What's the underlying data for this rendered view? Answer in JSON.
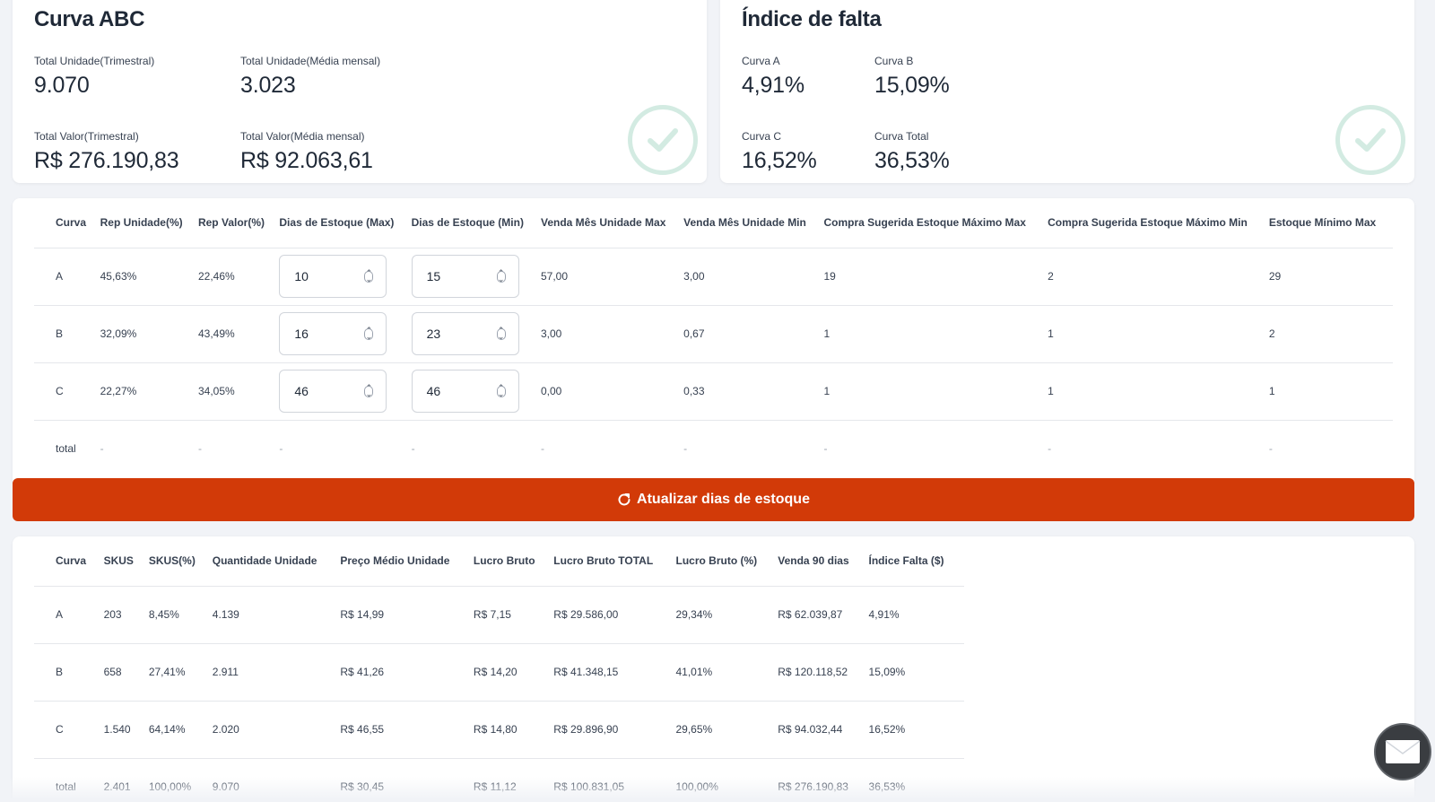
{
  "curva_abc": {
    "title": "Curva ABC",
    "total_unidade_trimestral": {
      "label": "Total Unidade(Trimestral)",
      "value": "9.070"
    },
    "total_unidade_media": {
      "label": "Total Unidade(Média mensal)",
      "value": "3.023"
    },
    "total_valor_trimestral": {
      "label": "Total Valor(Trimestral)",
      "value": "R$ 276.190,83"
    },
    "total_valor_media": {
      "label": "Total Valor(Média mensal)",
      "value": "R$ 92.063,61"
    },
    "status_icon": "check-circle-icon"
  },
  "indice_falta": {
    "title": "Índice de falta",
    "curva_a": {
      "label": "Curva A",
      "value": "4,91%"
    },
    "curva_b": {
      "label": "Curva B",
      "value": "15,09%"
    },
    "curva_c": {
      "label": "Curva C",
      "value": "16,52%"
    },
    "curva_total": {
      "label": "Curva Total",
      "value": "36,53%"
    },
    "status_icon": "check-circle-icon"
  },
  "estoque_table": {
    "headers": [
      "Curva",
      "Rep Unidade(%)",
      "Rep Valor(%)",
      "Dias de Estoque (Max)",
      "Dias de Estoque (Min)",
      "Venda Mês Unidade Max",
      "Venda Mês Unidade Min",
      "Compra Sugerida Estoque Máximo Max",
      "Compra Sugerida Estoque Máximo Min",
      "Estoque Mínimo Max"
    ],
    "rows": [
      {
        "curva": "A",
        "rep_unidade": "45,63%",
        "rep_valor": "22,46%",
        "dias_max": "10",
        "dias_min": "15",
        "venda_max": "57,00",
        "venda_min": "3,00",
        "compra_max": "19",
        "compra_min": "2",
        "estoque_min_max": "29"
      },
      {
        "curva": "B",
        "rep_unidade": "32,09%",
        "rep_valor": "43,49%",
        "dias_max": "16",
        "dias_min": "23",
        "venda_max": "3,00",
        "venda_min": "0,67",
        "compra_max": "1",
        "compra_min": "1",
        "estoque_min_max": "2"
      },
      {
        "curva": "C",
        "rep_unidade": "22,27%",
        "rep_valor": "34,05%",
        "dias_max": "46",
        "dias_min": "46",
        "venda_max": "0,00",
        "venda_min": "0,33",
        "compra_max": "1",
        "compra_min": "1",
        "estoque_min_max": "1"
      }
    ],
    "total_row": {
      "curva": "total",
      "placeholder": "-"
    }
  },
  "update_button": {
    "label": "Atualizar dias de estoque",
    "icon": "refresh-icon",
    "color": "#d23a08"
  },
  "resumo_table": {
    "headers": [
      "Curva",
      "SKUS",
      "SKUS(%)",
      "Quantidade Unidade",
      "Preço Médio Unidade",
      "Lucro Bruto",
      "Lucro Bruto TOTAL",
      "Lucro Bruto (%)",
      "Venda 90 dias",
      "Índice Falta ($)"
    ],
    "rows": [
      [
        "A",
        "203",
        "8,45%",
        "4.139",
        "R$ 14,99",
        "R$ 7,15",
        "R$ 29.586,00",
        "29,34%",
        "R$ 62.039,87",
        "4,91%"
      ],
      [
        "B",
        "658",
        "27,41%",
        "2.911",
        "R$ 41,26",
        "R$ 14,20",
        "R$ 41.348,15",
        "41,01%",
        "R$ 120.118,52",
        "15,09%"
      ],
      [
        "C",
        "1.540",
        "64,14%",
        "2.020",
        "R$ 46,55",
        "R$ 14,80",
        "R$ 29.896,90",
        "29,65%",
        "R$ 94.032,44",
        "16,52%"
      ],
      [
        "total",
        "2.401",
        "100,00%",
        "9.070",
        "R$ 30,45",
        "R$ 11,12",
        "R$ 100.831,05",
        "100,00%",
        "R$ 276.190,83",
        "36,53%"
      ]
    ]
  },
  "chat": {
    "icon": "chat-envelope-icon"
  }
}
